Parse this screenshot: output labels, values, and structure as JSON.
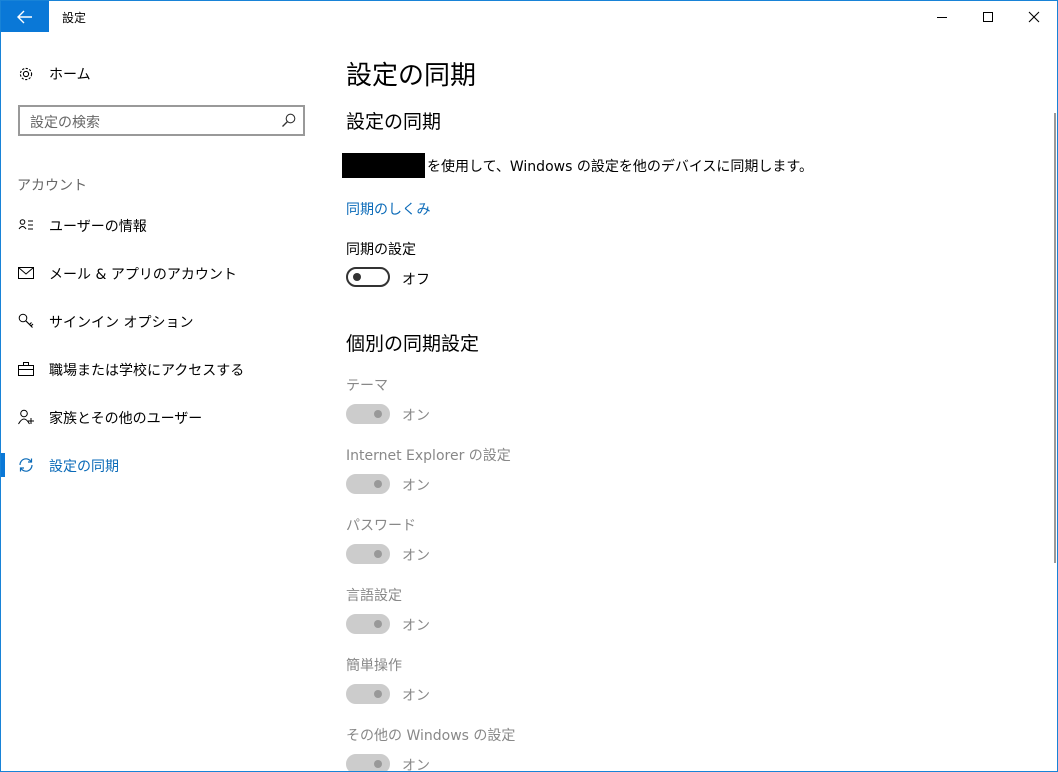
{
  "window": {
    "title": "設定"
  },
  "sidebar": {
    "home_label": "ホーム",
    "search_placeholder": "設定の検索",
    "section_label": "アカウント",
    "items": [
      {
        "label": "ユーザーの情報",
        "icon": "user-info-icon"
      },
      {
        "label": "メール & アプリのアカウント",
        "icon": "mail-icon"
      },
      {
        "label": "サインイン オプション",
        "icon": "key-icon"
      },
      {
        "label": "職場または学校にアクセスする",
        "icon": "briefcase-icon"
      },
      {
        "label": "家族とその他のユーザー",
        "icon": "person-add-icon"
      },
      {
        "label": "設定の同期",
        "icon": "sync-icon",
        "active": true
      }
    ]
  },
  "main": {
    "page_title": "設定の同期",
    "section1_title": "設定の同期",
    "description": "を使用して、Windows の設定を他のデバイスに同期します。",
    "link_label": "同期のしくみ",
    "sync_settings_label": "同期の設定",
    "sync_settings_state": "オフ",
    "section2_title": "個別の同期設定",
    "individual": [
      {
        "label": "テーマ",
        "state": "オン"
      },
      {
        "label": "Internet Explorer の設定",
        "state": "オン"
      },
      {
        "label": "パスワード",
        "state": "オン"
      },
      {
        "label": "言語設定",
        "state": "オン"
      },
      {
        "label": "簡単操作",
        "state": "オン"
      },
      {
        "label": "その他の Windows の設定",
        "state": "オン"
      }
    ]
  },
  "colors": {
    "accent": "#0a78d7",
    "link": "#0a6ab8",
    "disabled": "#cccccc"
  }
}
